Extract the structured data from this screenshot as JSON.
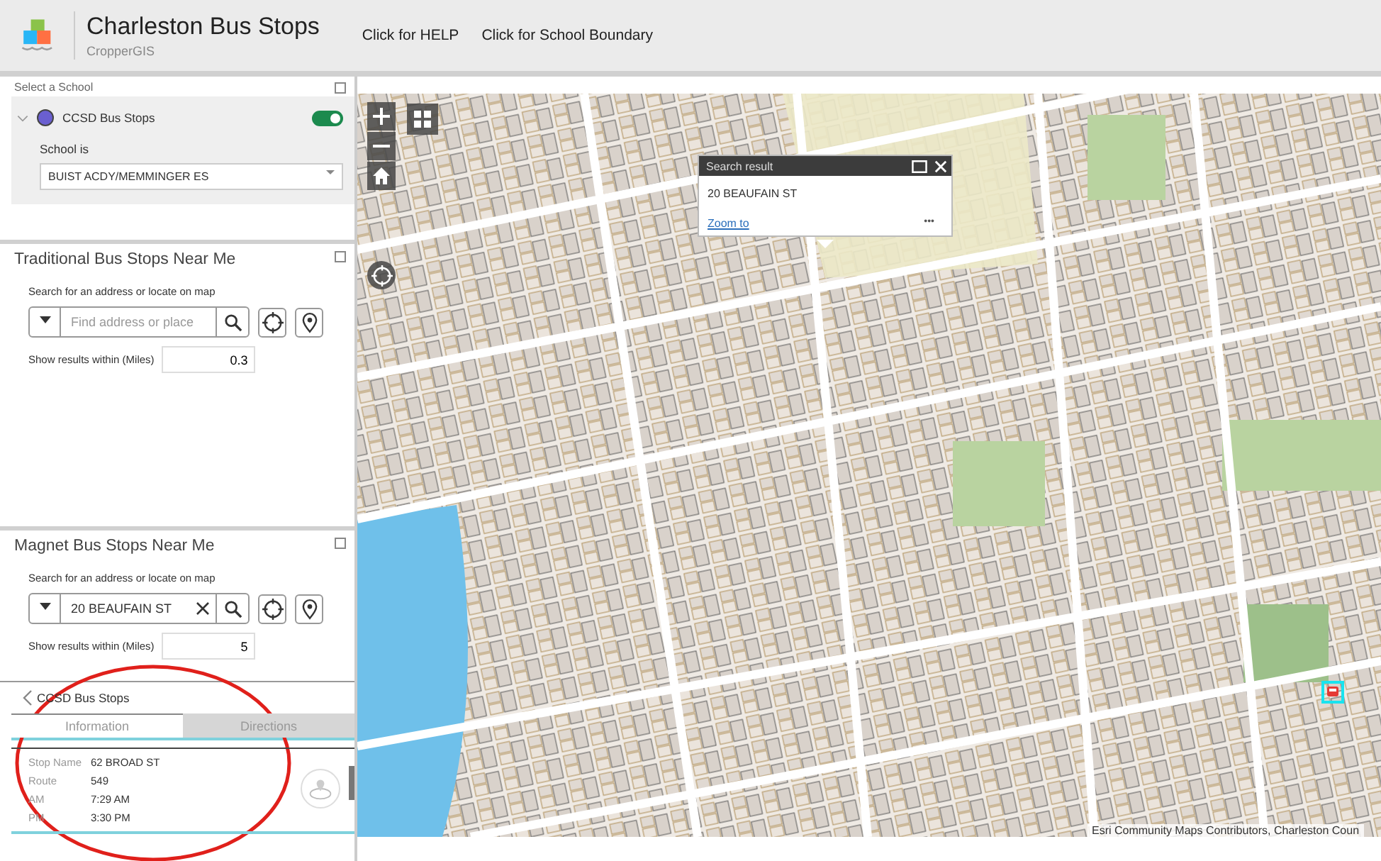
{
  "header": {
    "title": "Charleston Bus Stops",
    "subtitle": "CropperGIS",
    "links": [
      "Click for HELP",
      "Click for School Boundary"
    ]
  },
  "select_school": {
    "title": "Select a School",
    "layer": {
      "name": "CCSD Bus Stops",
      "on": true
    },
    "filter_label": "School is",
    "filter_value": "BUIST ACDY/MEMMINGER ES"
  },
  "search_panels": [
    {
      "title": "Traditional Bus Stops Near Me",
      "hint": "Search for an address or locate on map",
      "search": {
        "placeholder": "Find address or place"
      },
      "distance_label": "Show results within (Miles)",
      "distance": "0.3"
    },
    {
      "title": "Magnet Bus Stops Near Me",
      "hint": "Search for an address or locate on map",
      "search": {
        "value": "20 BEAUFAIN ST"
      },
      "distance_label": "Show results within (Miles)",
      "distance": "5"
    }
  ],
  "feature_info": {
    "title": "CCSD Bus Stops",
    "tabs": [
      {
        "label": "Information",
        "selected": true
      },
      {
        "label": "Directions",
        "selected": false
      }
    ],
    "fields": [
      {
        "label": "Stop Name",
        "value": "62 BROAD ST"
      },
      {
        "label": "Route",
        "value": "549"
      },
      {
        "label": "AM",
        "value": "7:29 AM"
      },
      {
        "label": "PM",
        "value": "3:30 PM"
      }
    ]
  },
  "map": {
    "popup": {
      "title": "Search result",
      "address": "20 BEAUFAIN ST",
      "link": "Zoom to",
      "more": "•••"
    },
    "attribution": "Esri Community Maps Contributors, Charleston Coun"
  }
}
